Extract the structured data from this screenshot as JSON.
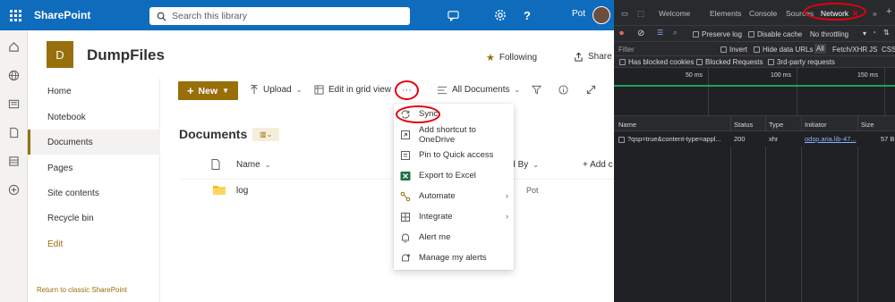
{
  "sharepoint": {
    "brand": "SharePoint",
    "search": {
      "placeholder": "Search this library"
    },
    "user": {
      "name": "Pot"
    },
    "site": {
      "logo_letter": "D",
      "title": "DumpFiles",
      "following_label": "Following",
      "share_label": "Share"
    },
    "leftnav": {
      "items": [
        {
          "label": "Home"
        },
        {
          "label": "Notebook"
        },
        {
          "label": "Documents",
          "selected": true
        },
        {
          "label": "Pages"
        },
        {
          "label": "Site contents"
        },
        {
          "label": "Recycle bin"
        },
        {
          "label": "Edit"
        }
      ],
      "classic_link": "Return to classic SharePoint"
    },
    "commandbar": {
      "new_label": "New",
      "upload_label": "Upload",
      "grid_label": "Edit in grid view",
      "more_label": "···",
      "view_label": "All Documents"
    },
    "library": {
      "title": "Documents",
      "columns": {
        "name": "Name",
        "modified_by": "Modified By",
        "add_column": "+ Add c"
      },
      "rows": [
        {
          "name": "log",
          "modified_by": "Pot"
        }
      ]
    },
    "menu": {
      "items": [
        {
          "label": "Sync",
          "icon": "sync-icon"
        },
        {
          "label": "Add shortcut to OneDrive",
          "icon": "add-shortcut-icon"
        },
        {
          "label": "Pin to Quick access",
          "icon": "pin-icon"
        },
        {
          "label": "Export to Excel",
          "icon": "excel-icon"
        },
        {
          "label": "Automate",
          "icon": "automate-icon",
          "submenu": true
        },
        {
          "label": "Integrate",
          "icon": "integrate-icon",
          "submenu": true
        },
        {
          "label": "Alert me",
          "icon": "bell-icon"
        },
        {
          "label": "Manage my alerts",
          "icon": "manage-alerts-icon"
        }
      ]
    },
    "colors": {
      "suite_bar": "#0f6cbd",
      "accent": "#986f0b",
      "highlight": "#e8000b"
    }
  },
  "devtools": {
    "tabs": {
      "welcome": "Welcome",
      "elements": "Elements",
      "console": "Console",
      "sources": "Sources",
      "network": "Network"
    },
    "toolbar": {
      "preserve_log": "Preserve log",
      "disable_cache": "Disable cache",
      "throttling": "No throttling"
    },
    "filter": {
      "placeholder": "Filter",
      "invert": "Invert",
      "hide_data_urls": "Hide data URLs",
      "all": "All",
      "fetch_xhr": "Fetch/XHR",
      "js": "JS",
      "css": "CSS"
    },
    "filter2": {
      "has_blocked_cookies": "Has blocked cookies",
      "blocked_requests": "Blocked Requests",
      "third_party": "3rd-party requests"
    },
    "timeline": {
      "ticks": [
        "50 ms",
        "100 ms",
        "150 ms"
      ]
    },
    "grid": {
      "headers": {
        "name": "Name",
        "status": "Status",
        "type": "Type",
        "initiator": "Initiator",
        "size": "Size"
      },
      "rows": [
        {
          "name": "?qsp=true&content-type=appl...",
          "status": "200",
          "type": "xhr",
          "initiator": "odsp.aria.lib-47...",
          "size": "57 B"
        }
      ]
    }
  }
}
